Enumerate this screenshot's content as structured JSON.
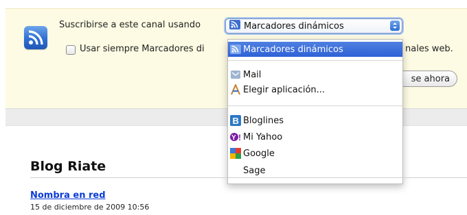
{
  "subscribe": {
    "label": "Suscribirse a este canal usando",
    "checkbox_label": "Usar siempre Marcadores di",
    "checkbox_label_tail": "nales web.",
    "button_label": "se ahora",
    "checkbox_checked": false
  },
  "select": {
    "selected": "Marcadores dinámicos"
  },
  "menu": {
    "items": [
      {
        "label": "Marcadores dinámicos",
        "icon": "live-bookmarks-icon",
        "selected": true
      },
      {
        "label": "Mail",
        "icon": "mail-app-icon",
        "selected": false
      },
      {
        "label": "Elegir aplicación...",
        "icon": "choose-app-icon",
        "selected": false
      },
      {
        "label": "Bloglines",
        "icon": "bloglines-icon",
        "selected": false
      },
      {
        "label": "Mi Yahoo",
        "icon": "yahoo-icon",
        "selected": false
      },
      {
        "label": "Google",
        "icon": "google-icon",
        "selected": false
      },
      {
        "label": "Sage",
        "icon": "",
        "selected": false
      }
    ]
  },
  "blog": {
    "title": "Blog Riate",
    "post_title": "Nombra en red",
    "post_date": "15 de diciembre de 2009 10:56"
  },
  "colors": {
    "bar_background": "#fdfbe3",
    "selection_blue": "#2e62d6",
    "link_blue": "#0b3bd6"
  }
}
